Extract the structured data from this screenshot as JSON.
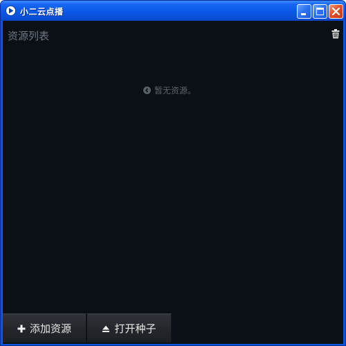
{
  "window": {
    "title": "小二云点播"
  },
  "titlebar_controls": {
    "minimize": "minimize-button",
    "maximize": "maximize-button",
    "close": "close-button"
  },
  "panel": {
    "title": "资源列表",
    "clear_icon": "trash-icon",
    "empty_message": "暂无资源。",
    "empty_icon": "chevron-circle-icon"
  },
  "toolbar": {
    "add_label": "添加资源",
    "add_icon": "plus-icon",
    "open_label": "打开种子",
    "open_icon": "eject-icon"
  },
  "colors": {
    "titlebar": "#0a58e6",
    "background": "#0b1016",
    "muted_text": "#6e7681",
    "button_text": "#e8e8e8",
    "close_button": "#e2502a"
  }
}
